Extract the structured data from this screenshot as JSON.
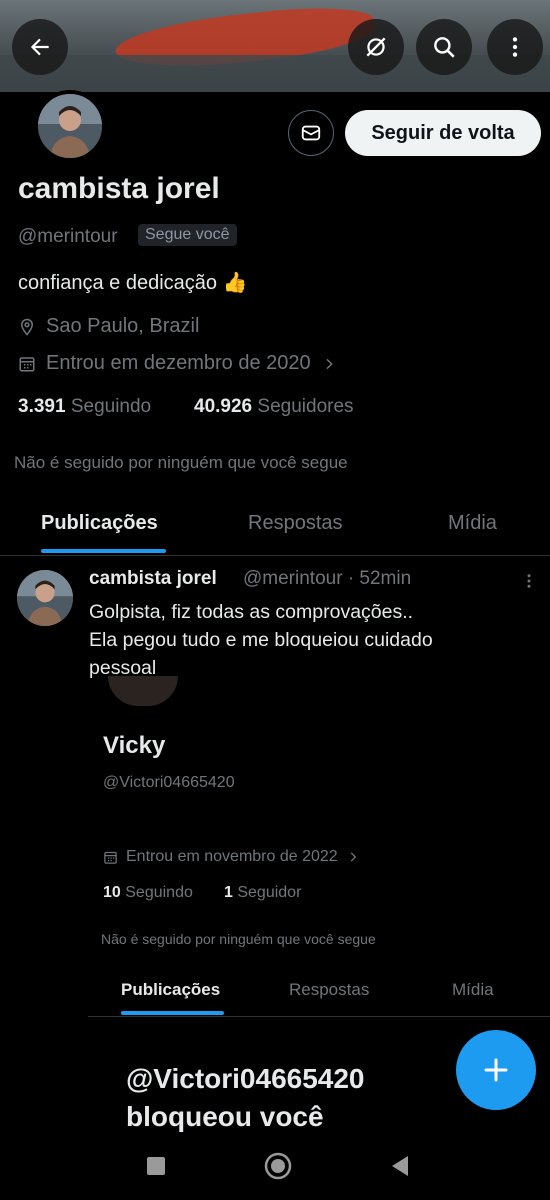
{
  "profile": {
    "follow_back_label": "Seguir de volta",
    "name": "cambista jorel",
    "handle": "@merintour",
    "follows_you": "Segue você",
    "bio": "confiança e dedicação 👍",
    "location": "Sao Paulo, Brazil",
    "joined": "Entrou em dezembro de 2020",
    "following_count": "3.391",
    "following_label": "Seguindo",
    "followers_count": "40.926",
    "followers_label": "Seguidores",
    "mutual": "Não é seguido por ninguém que você segue"
  },
  "tabs": [
    "Publicações",
    "Respostas",
    "Mídia"
  ],
  "tweet": {
    "name": "cambista jorel",
    "handle_time": "@merintour · 52min",
    "text_line1": "Golpista, fiz todas as comprovações..",
    "text_line2": "Ela pegou tudo e me bloqueiou cuidado",
    "text_line3": "pessoal"
  },
  "embedded": {
    "name": "Vicky",
    "handle": "@Victori04665420",
    "joined": "Entrou em novembro de 2022",
    "following_count": "10",
    "following_label": "Seguindo",
    "followers_count": "1",
    "followers_label": "Seguidor",
    "mutual": "Não é seguido por ninguém que você segue",
    "tabs": [
      "Publicações",
      "Respostas",
      "Mídia"
    ],
    "blocked_line1": "@Victori04665420",
    "blocked_line2": "bloqueou você"
  },
  "icons": {
    "back": "back-arrow-icon",
    "grok": "grok-icon",
    "search": "search-icon",
    "more": "more-vertical-icon",
    "message": "envelope-icon",
    "location": "location-pin-icon",
    "calendar": "calendar-icon",
    "compose": "plus-icon"
  },
  "colors": {
    "accent": "#1d9bf0",
    "background": "#000000",
    "muted": "#71767b"
  }
}
